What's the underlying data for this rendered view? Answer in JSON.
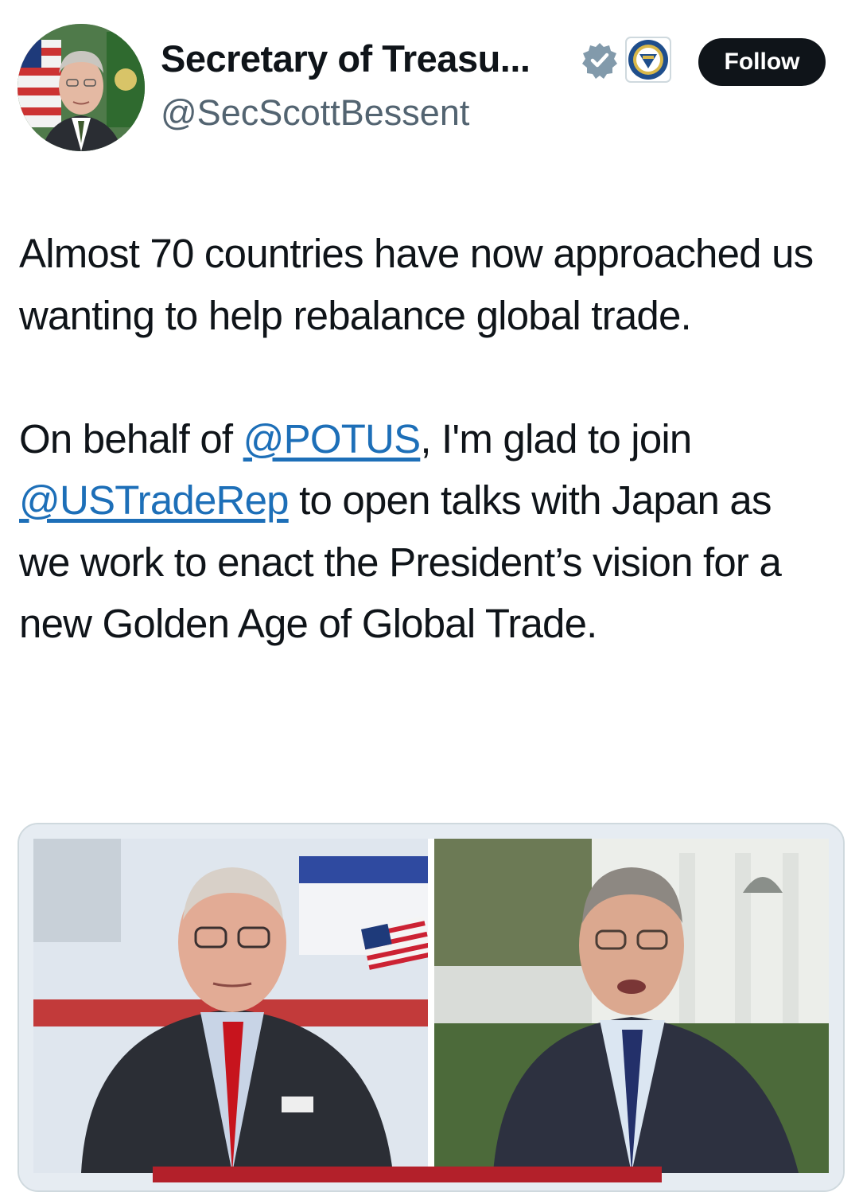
{
  "account": {
    "display_name": "Secretary of Treasu...",
    "handle": "@SecScottBessent",
    "avatar_icon": "profile-photo",
    "verified_icon": "verified-badge-icon",
    "affiliate_icon": "treasury-seal-icon",
    "follow_label": "Follow"
  },
  "tweet": {
    "para1": "Almost 70 countries have now approached us wanting to help rebalance global trade.",
    "para2_prefix": "On behalf of ",
    "mention1": "@POTUS",
    "para2_mid": ", I'm glad to join ",
    "mention2": "@USTradeRep",
    "para2_suffix": " to open talks with Japan as we work to enact the President’s vision for a new Golden Age of Global Trade."
  },
  "media": {
    "type": "video-still",
    "description_icon": "split-screen-news-broadcast"
  },
  "colors": {
    "text": "#0f1419",
    "secondary": "#536471",
    "link": "#1d6fb8",
    "follow_bg": "#0f1419"
  }
}
